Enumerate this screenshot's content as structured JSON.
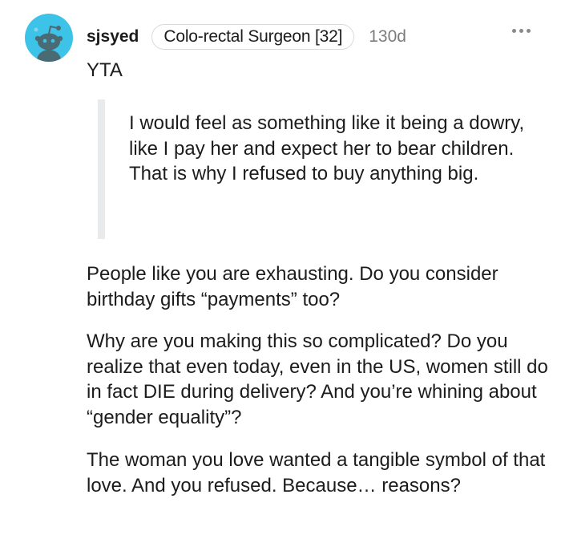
{
  "comment": {
    "username": "sjsyed",
    "flair": "Colo-rectal Surgeon [32]",
    "age": "130d",
    "verdict": "YTA",
    "quote": "I would feel as something like it being a dowry, like I pay her and expect her to bear children. That is why I refused to buy anything big.",
    "paragraphs": [
      "People like you are exhausting. Do you consider birthday gifts “payments” too?",
      "Why are you making this so complicated? Do you realize that even today, even in the US, women still do in fact DIE during delivery? And you’re whining about “gender equality”?",
      "The woman you love wanted a tangible symbol of that love. And you refused. Because… reasons?"
    ]
  },
  "icons": {
    "avatar": "reddit-snoo-avatar",
    "more": "more-options-icon"
  },
  "colors": {
    "avatar_bg": "#3ec3e8",
    "quote_bar": "#e9eaeb",
    "meta_text": "#7c7c7c"
  }
}
